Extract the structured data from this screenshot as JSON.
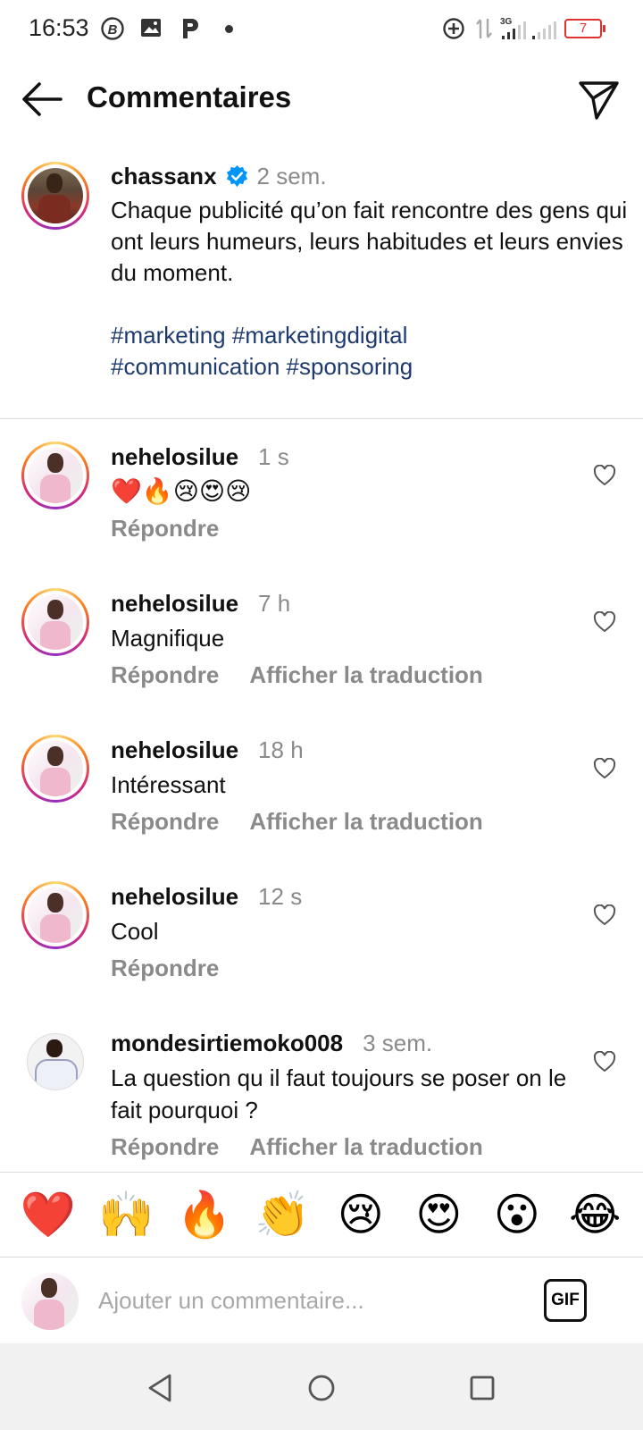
{
  "status_bar": {
    "time": "16:53",
    "network": "3G",
    "battery": "7",
    "icons": [
      "b-icon",
      "gallery-icon",
      "p-icon",
      "dot-icon",
      "add-circle-icon",
      "data-arrows-icon",
      "signal-icon",
      "signal-icon",
      "battery-icon"
    ]
  },
  "header": {
    "title": "Commentaires",
    "back_icon": "arrow-left-icon",
    "send_icon": "send-icon"
  },
  "post": {
    "username": "chassanx",
    "verified": true,
    "time": "2 sem.",
    "caption": "Chaque publicité qu’on fait rencontre des gens qui ont leurs humeurs, leurs habitudes et leurs envies du moment.",
    "hashtags": [
      "#marketing",
      "#marketingdigital",
      "#communication",
      "#sponsoring"
    ]
  },
  "comments": [
    {
      "username": "nehelosilue",
      "time": "1 s",
      "text": "❤️🔥😢😍😢",
      "reply": "Répondre",
      "translate": ""
    },
    {
      "username": "nehelosilue",
      "time": "7 h",
      "text": "Magnifique",
      "reply": "Répondre",
      "translate": "Afficher la traduction"
    },
    {
      "username": "nehelosilue",
      "time": "18 h",
      "text": "Intéressant",
      "reply": "Répondre",
      "translate": "Afficher la traduction"
    },
    {
      "username": "nehelosilue",
      "time": "12 s",
      "text": "Cool",
      "reply": "Répondre",
      "translate": ""
    },
    {
      "username": "mondesirtiemoko008",
      "time": "3 sem.",
      "text": "La question qu il faut toujours se poser on le fait pourquoi ?",
      "reply": "Répondre",
      "translate": "Afficher la traduction"
    }
  ],
  "quick_emojis": [
    "❤️",
    "🙌",
    "🔥",
    "👏",
    "😢",
    "😍",
    "😮",
    "😂"
  ],
  "input": {
    "placeholder": "Ajouter un commentaire...",
    "gif_label": "GIF"
  },
  "colors": {
    "hashtag": "#1e3a6e",
    "verified": "#0095f6",
    "muted": "#8a8a8a",
    "battery": "#e03131"
  }
}
